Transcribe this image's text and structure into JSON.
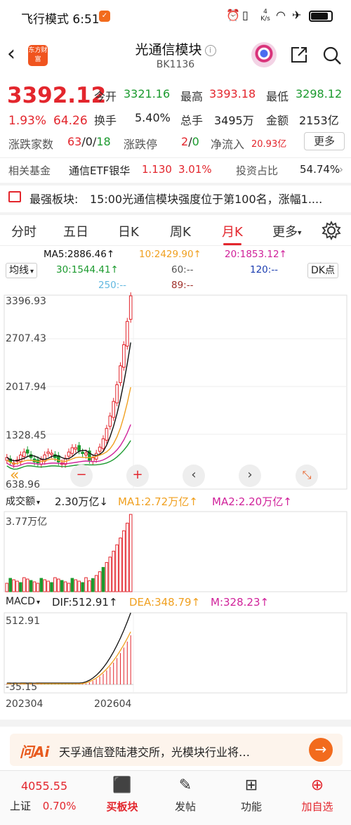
{
  "status_bar": {
    "label": "飞行模式 6:51",
    "net_speed": "4 K/s"
  },
  "header": {
    "title": "光通信模块",
    "code": "BK1136",
    "logo_text": "东方财富"
  },
  "quote": {
    "price": "3392.12",
    "pct": "1.93%",
    "change": "64.26",
    "open_label": "今开",
    "open": "3321.16",
    "high_label": "最高",
    "high": "3393.18",
    "low_label": "最低",
    "low": "3298.12",
    "turnover_label": "换手",
    "turnover": "5.40%",
    "volume_label": "总手",
    "volume": "3495万",
    "amount_label": "金额",
    "amount": "2153亿",
    "updown_label": "涨跌家数",
    "up": "63",
    "flat": "0",
    "down": "18",
    "limit_label": "涨跌停",
    "limit_up": "2",
    "limit_down": "0",
    "inflow_label": "净流入",
    "inflow": "20.93亿",
    "more": "更多"
  },
  "fund": {
    "label": "相关基金",
    "name": "通信ETF银华",
    "price": "1.130",
    "pct": "3.01%",
    "weight_label": "投资占比",
    "weight": "54.74%"
  },
  "notice": {
    "label": "最强板块:",
    "text": "15:00光通信模块强度位于第100名，涨幅1...."
  },
  "tabs": [
    "分时",
    "五日",
    "日K",
    "周K",
    "月K",
    "更多"
  ],
  "active_tab": "月K",
  "ma": {
    "ma5": "MA5:2886.46↑",
    "ma10": "10:2429.90↑",
    "ma20": "20:1853.12↑",
    "ma30": "30:1544.41↑",
    "ma60": "60:--",
    "ma120": "120:--",
    "ma250": "250:--",
    "ma89": "89:--",
    "indicator_select": "均线",
    "dk_button": "DK点"
  },
  "price_axis": [
    "3396.93",
    "2707.43",
    "2017.94",
    "1328.45",
    "638.96"
  ],
  "volume_panel": {
    "select": "成交额",
    "value": "2.30万亿↓",
    "ma1": "MA1:2.72万亿↑",
    "ma2": "MA2:2.20万亿↑",
    "axis_top": "3.77万亿"
  },
  "macd_panel": {
    "select": "MACD",
    "dif": "DIF:512.91↑",
    "dea": "DEA:348.79↑",
    "m": "M:328.23↑",
    "axis_top": "512.91",
    "axis_bottom": "-35.15"
  },
  "x_axis": [
    "202304",
    "202604"
  ],
  "ai": {
    "logo": "问Ai",
    "text": "天孚通信登陆港交所，光模块行业将…"
  },
  "bottom_nav": {
    "index_value": "4055.55",
    "index_name": "上证",
    "index_pct": "0.70%",
    "items": [
      "买板块",
      "发帖",
      "功能",
      "加自选"
    ]
  },
  "colors": {
    "up": "#e3262d",
    "down": "#1b9a2e",
    "ma5": "#111111",
    "ma10": "#f0a020",
    "ma20": "#d0219a",
    "ma30": "#1b9a2e"
  }
}
